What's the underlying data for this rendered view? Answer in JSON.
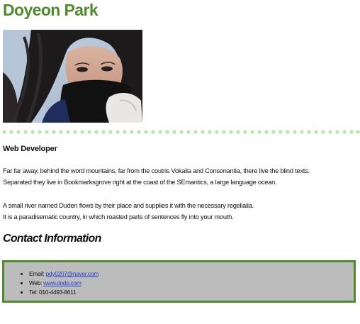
{
  "profile": {
    "name": "Doyeon Park",
    "photo_alt": "Profile photo",
    "role": "Web Developer"
  },
  "bio": {
    "paragraph1_line1": "Far far away, behind the word mountains, far from the coutris Vokalia and Consonantia, there live the blind texts.",
    "paragraph1_line2": "Separated they live in Bookmarksgrove right at the coast of the SEmantics, a large language ocean.",
    "paragraph2_line1": "A small river named Duden flows by their place and supplies it with the necessary regelialia.",
    "paragraph2_line2": "It is a paradisematic country, in which roasted parts of sentences fly into your mouth."
  },
  "contact": {
    "heading": "Contact Information",
    "email_label": "Email:",
    "email_value": "pdy0207@naver.com",
    "web_label": "Web:",
    "web_value": "www.dodo.com",
    "tel_label": "Tel:",
    "tel_value": "010-4493-8611"
  },
  "colors": {
    "accent": "#4f8a2c",
    "divider_dots": "#b7e6a8",
    "contact_bg": "#bcbcbc",
    "link": "#2a3fd0"
  },
  "icons": {
    "divider": "dotted-divider"
  }
}
